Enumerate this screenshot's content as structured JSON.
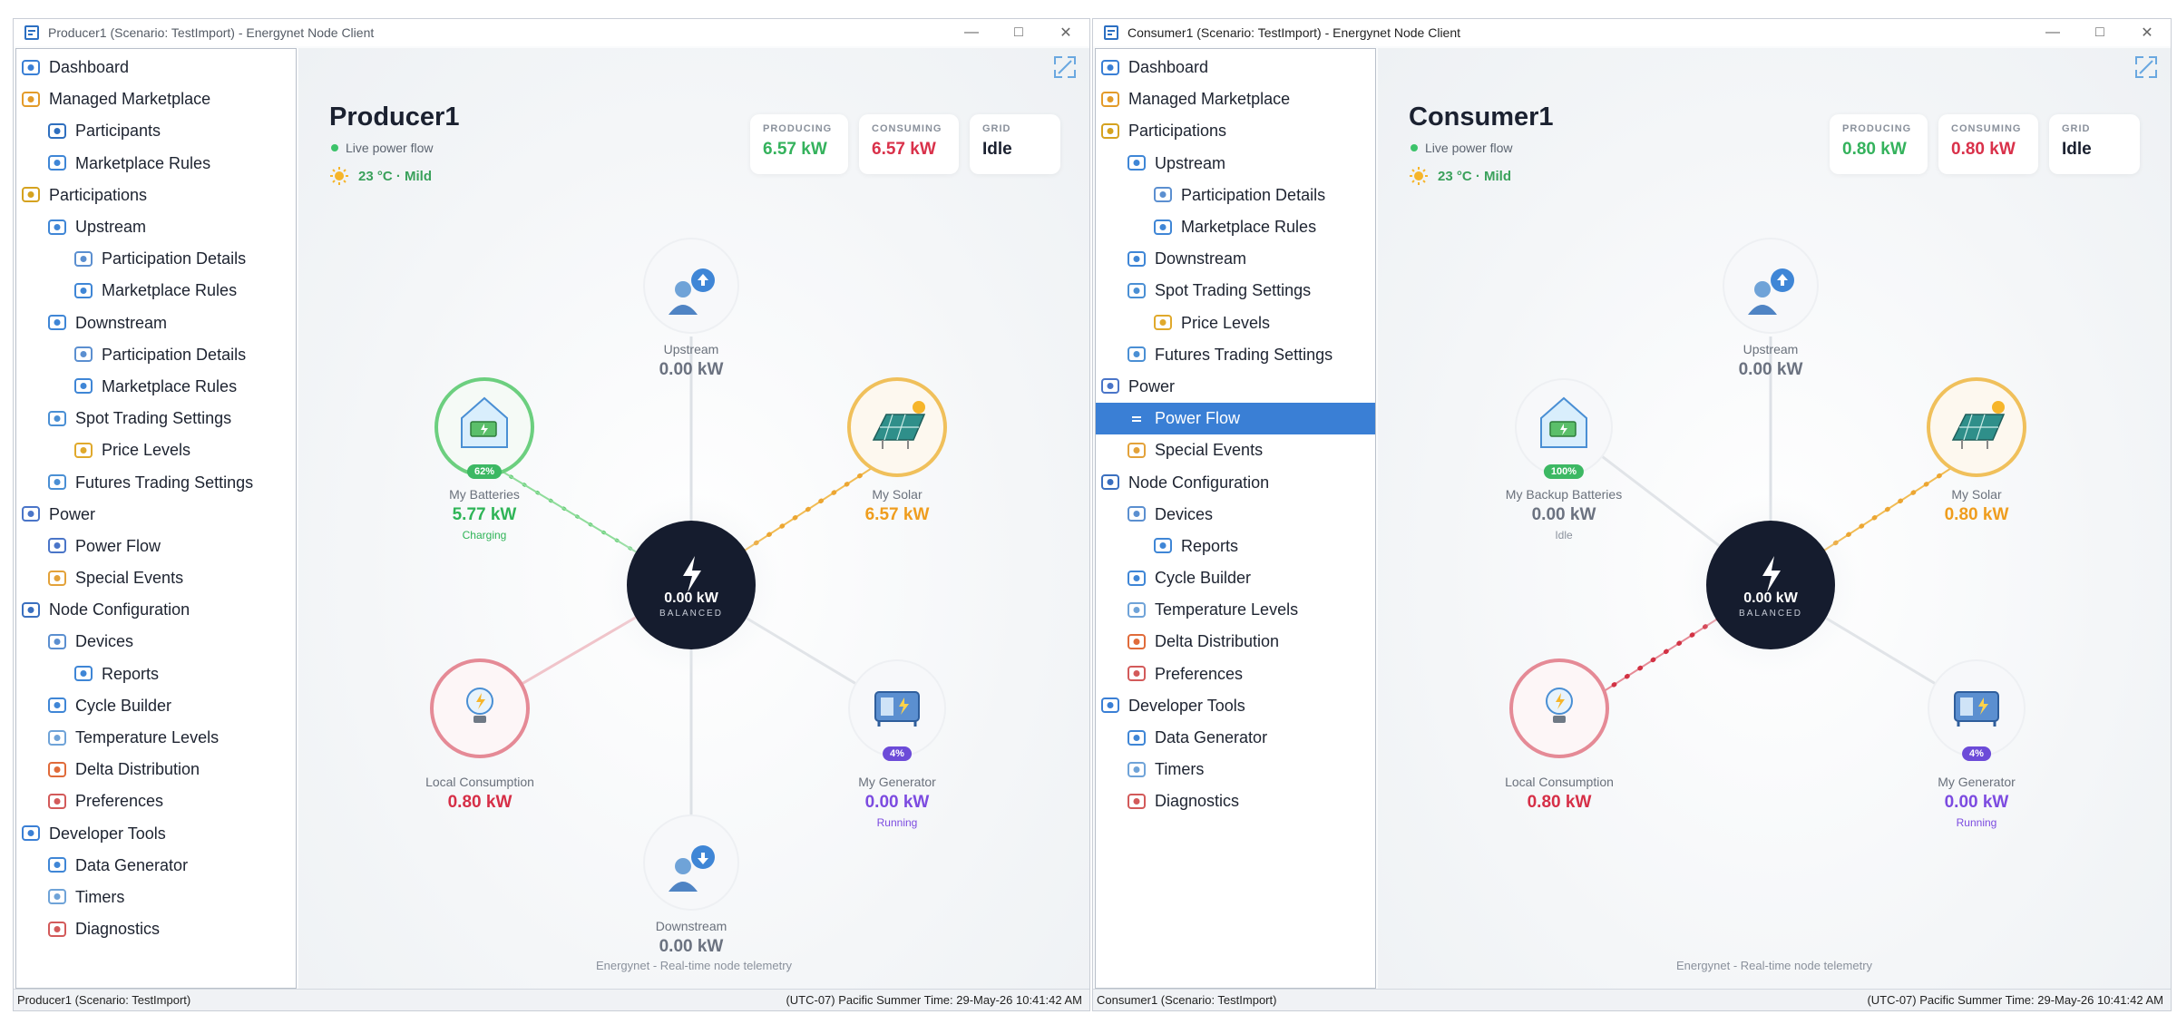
{
  "colors": {
    "accent": "#3a7fd5",
    "green": "#34b25c",
    "orange": "#ef9d1e",
    "red": "#d9314a",
    "purple": "#7c4be0",
    "hub": "#151c2e"
  },
  "producer": {
    "window_title": "Producer1 (Scenario: TestImport) - Energynet Node Client",
    "sidebar": [
      {
        "label": "Dashboard",
        "level": 0,
        "icon": "dashboard-icon"
      },
      {
        "label": "Managed Marketplace",
        "level": 0,
        "icon": "marketplace-icon"
      },
      {
        "label": "Participants",
        "level": 1,
        "icon": "participants-icon"
      },
      {
        "label": "Marketplace Rules",
        "level": 1,
        "icon": "rules-icon"
      },
      {
        "label": "Participations",
        "level": 0,
        "icon": "participations-icon"
      },
      {
        "label": "Upstream",
        "level": 1,
        "icon": "upstream-icon"
      },
      {
        "label": "Participation Details",
        "level": 2,
        "icon": "details-icon"
      },
      {
        "label": "Marketplace Rules",
        "level": 2,
        "icon": "rules-icon"
      },
      {
        "label": "Downstream",
        "level": 1,
        "icon": "downstream-icon"
      },
      {
        "label": "Participation Details",
        "level": 2,
        "icon": "details-icon"
      },
      {
        "label": "Marketplace Rules",
        "level": 2,
        "icon": "rules-icon"
      },
      {
        "label": "Spot Trading Settings",
        "level": 1,
        "icon": "trading-icon"
      },
      {
        "label": "Price Levels",
        "level": 2,
        "icon": "price-icon"
      },
      {
        "label": "Futures Trading Settings",
        "level": 1,
        "icon": "trading-icon"
      },
      {
        "label": "Power",
        "level": 0,
        "icon": "power-icon"
      },
      {
        "label": "Power Flow",
        "level": 1,
        "icon": "power-flow-icon"
      },
      {
        "label": "Special Events",
        "level": 1,
        "icon": "events-icon"
      },
      {
        "label": "Node Configuration",
        "level": 0,
        "icon": "config-icon"
      },
      {
        "label": "Devices",
        "level": 1,
        "icon": "devices-icon"
      },
      {
        "label": "Reports",
        "level": 2,
        "icon": "reports-icon"
      },
      {
        "label": "Cycle Builder",
        "level": 1,
        "icon": "cycle-icon"
      },
      {
        "label": "Temperature Levels",
        "level": 1,
        "icon": "temperature-icon"
      },
      {
        "label": "Delta Distribution",
        "level": 1,
        "icon": "delta-icon"
      },
      {
        "label": "Preferences",
        "level": 1,
        "icon": "preferences-icon"
      },
      {
        "label": "Developer Tools",
        "level": 0,
        "icon": "devtools-icon"
      },
      {
        "label": "Data Generator",
        "level": 1,
        "icon": "generator-data-icon"
      },
      {
        "label": "Timers",
        "level": 1,
        "icon": "timer-icon"
      },
      {
        "label": "Diagnostics",
        "level": 1,
        "icon": "diagnostics-icon"
      }
    ],
    "title": "Producer1",
    "live": "Live power flow",
    "weather": "23 °C · Mild",
    "stats": {
      "producing_label": "PRODUCING",
      "producing": "6.57 kW",
      "consuming_label": "CONSUMING",
      "consuming": "6.57 kW",
      "grid_label": "GRID",
      "grid": "Idle"
    },
    "nodes": {
      "upstream_name": "Upstream",
      "upstream_kw": "0.00 kW",
      "batteries_name": "My Batteries",
      "batteries_kw": "5.77 kW",
      "batteries_status": "Charging",
      "batteries_badge": "62%",
      "solar_name": "My Solar",
      "solar_kw": "6.57 kW",
      "local_name": "Local Consumption",
      "local_kw": "0.80 kW",
      "generator_name": "My Generator",
      "generator_kw": "0.00 kW",
      "generator_status": "Running",
      "generator_badge": "4%",
      "downstream_name": "Downstream",
      "downstream_kw": "0.00 kW",
      "hub_kw": "0.00 kW",
      "hub_status": "BALANCED"
    },
    "footer": "Energynet - Real-time node telemetry",
    "status_left": "Producer1 (Scenario: TestImport)",
    "status_right": "(UTC-07) Pacific Summer Time: 29-May-26 10:41:42 AM"
  },
  "consumer": {
    "window_title": "Consumer1 (Scenario: TestImport) - Energynet Node Client",
    "sidebar": [
      {
        "label": "Dashboard",
        "level": 0,
        "icon": "dashboard-icon"
      },
      {
        "label": "Managed Marketplace",
        "level": 0,
        "icon": "marketplace-icon"
      },
      {
        "label": "Participations",
        "level": 0,
        "icon": "participations-icon"
      },
      {
        "label": "Upstream",
        "level": 1,
        "icon": "upstream-icon"
      },
      {
        "label": "Participation Details",
        "level": 2,
        "icon": "details-icon"
      },
      {
        "label": "Marketplace Rules",
        "level": 2,
        "icon": "rules-icon"
      },
      {
        "label": "Downstream",
        "level": 1,
        "icon": "downstream-icon"
      },
      {
        "label": "Spot Trading Settings",
        "level": 1,
        "icon": "trading-icon"
      },
      {
        "label": "Price Levels",
        "level": 2,
        "icon": "price-icon"
      },
      {
        "label": "Futures Trading Settings",
        "level": 1,
        "icon": "trading-icon"
      },
      {
        "label": "Power",
        "level": 0,
        "icon": "power-icon"
      },
      {
        "label": "Power Flow",
        "level": 1,
        "icon": "power-flow-icon",
        "selected": true
      },
      {
        "label": "Special Events",
        "level": 1,
        "icon": "events-icon"
      },
      {
        "label": "Node Configuration",
        "level": 0,
        "icon": "config-icon"
      },
      {
        "label": "Devices",
        "level": 1,
        "icon": "devices-icon"
      },
      {
        "label": "Reports",
        "level": 2,
        "icon": "reports-icon"
      },
      {
        "label": "Cycle Builder",
        "level": 1,
        "icon": "cycle-icon"
      },
      {
        "label": "Temperature Levels",
        "level": 1,
        "icon": "temperature-icon"
      },
      {
        "label": "Delta Distribution",
        "level": 1,
        "icon": "delta-icon"
      },
      {
        "label": "Preferences",
        "level": 1,
        "icon": "preferences-icon"
      },
      {
        "label": "Developer Tools",
        "level": 0,
        "icon": "devtools-icon"
      },
      {
        "label": "Data Generator",
        "level": 1,
        "icon": "generator-data-icon"
      },
      {
        "label": "Timers",
        "level": 1,
        "icon": "timer-icon"
      },
      {
        "label": "Diagnostics",
        "level": 1,
        "icon": "diagnostics-icon"
      }
    ],
    "title": "Consumer1",
    "live": "Live power flow",
    "weather": "23 °C · Mild",
    "stats": {
      "producing_label": "PRODUCING",
      "producing": "0.80 kW",
      "consuming_label": "CONSUMING",
      "consuming": "0.80 kW",
      "grid_label": "GRID",
      "grid": "Idle"
    },
    "nodes": {
      "upstream_name": "Upstream",
      "upstream_kw": "0.00 kW",
      "batteries_name": "My Backup Batteries",
      "batteries_kw": "0.00 kW",
      "batteries_status": "Idle",
      "batteries_badge": "100%",
      "solar_name": "My Solar",
      "solar_kw": "0.80 kW",
      "local_name": "Local Consumption",
      "local_kw": "0.80 kW",
      "generator_name": "My Generator",
      "generator_kw": "0.00 kW",
      "generator_status": "Running",
      "generator_badge": "4%",
      "hub_kw": "0.00 kW",
      "hub_status": "BALANCED"
    },
    "footer": "Energynet - Real-time node telemetry",
    "status_left": "Consumer1 (Scenario: TestImport)",
    "status_right": "(UTC-07) Pacific Summer Time: 29-May-26 10:41:42 AM"
  }
}
